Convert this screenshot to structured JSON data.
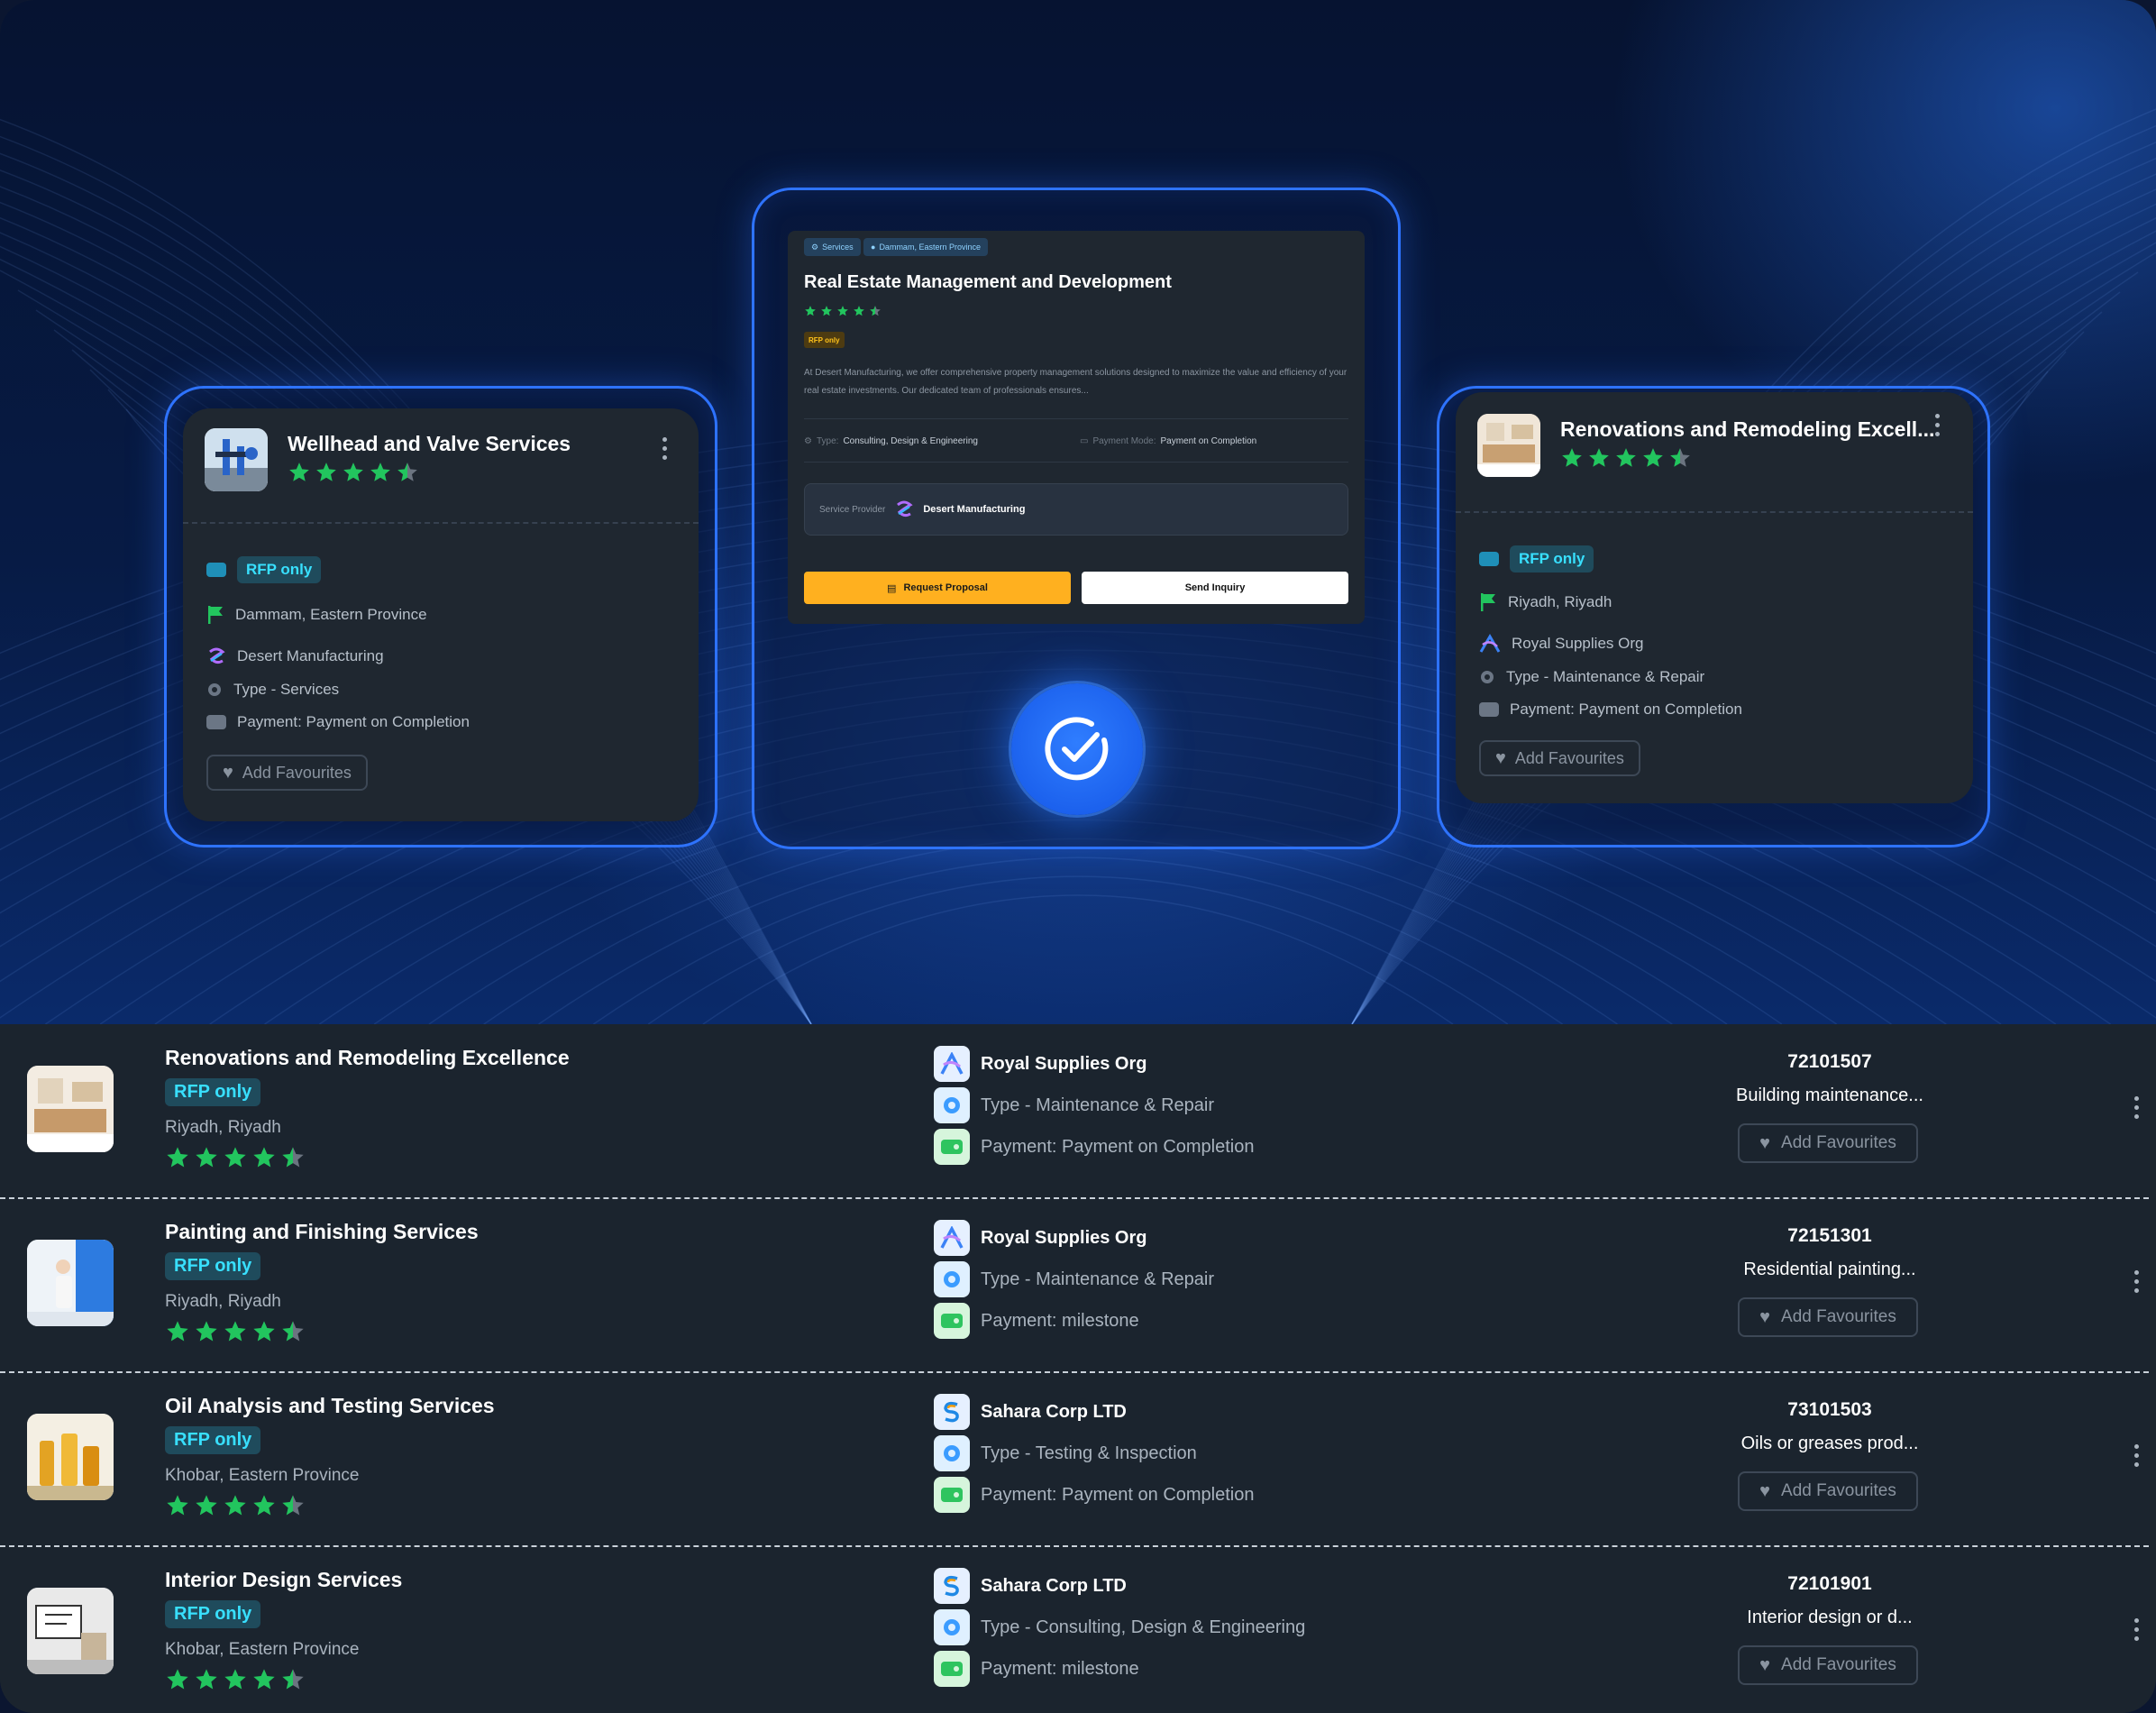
{
  "colors": {
    "accent_blue": "#2e73ff",
    "rfp_cyan": "#38e0ff",
    "star_green": "#22c55e",
    "request_orange": "#ffb01f",
    "card_bg": "#1f2730"
  },
  "center_card": {
    "chips": [
      "Services",
      "Dammam, Eastern Province"
    ],
    "title": "Real Estate Management and Development",
    "rating": 4.5,
    "rfp_label": "RFP only",
    "description": "At Desert Manufacturing, we offer comprehensive property management solutions designed to maximize the value and efficiency of your real estate investments. Our dedicated team of professionals ensures...",
    "type_label": "Type:",
    "type_value": "Consulting, Design & Engineering",
    "payment_label": "Payment Mode:",
    "payment_value": "Payment on Completion",
    "provider_label": "Service Provider",
    "provider_name": "Desert Manufacturing",
    "request_button": "Request Proposal",
    "inquiry_button": "Send Inquiry"
  },
  "left_card": {
    "title": "Wellhead and Valve Services",
    "rating": 4.5,
    "rfp_label": "RFP only",
    "location": "Dammam, Eastern Province",
    "provider": "Desert Manufacturing",
    "type": "Type - Services",
    "payment": "Payment: Payment on Completion",
    "fav_label": "Add Favourites"
  },
  "right_card": {
    "title": "Renovations and Remodeling Excell...",
    "rating": 4.5,
    "rfp_label": "RFP only",
    "location": "Riyadh, Riyadh",
    "provider": "Royal Supplies Org",
    "type": "Type - Maintenance & Repair",
    "payment": "Payment: Payment on Completion",
    "fav_label": "Add Favourites"
  },
  "list": [
    {
      "title": "Renovations and Remodeling Excellence",
      "rfp_label": "RFP only",
      "location": "Riyadh, Riyadh",
      "rating": 4.5,
      "provider": "Royal Supplies Org",
      "provider_icon": "royal-logo-icon",
      "type": "Type - Maintenance & Repair",
      "payment": "Payment: Payment on Completion",
      "code": "72101507",
      "desc": "Building maintenance...",
      "fav_label": "Add Favourites"
    },
    {
      "title": "Painting and Finishing Services",
      "rfp_label": "RFP only",
      "location": "Riyadh, Riyadh",
      "rating": 4.5,
      "provider": "Royal Supplies Org",
      "provider_icon": "royal-logo-icon",
      "type": "Type - Maintenance & Repair",
      "payment": "Payment: milestone",
      "code": "72151301",
      "desc": "Residential painting...",
      "fav_label": "Add Favourites"
    },
    {
      "title": "Oil Analysis and Testing Services",
      "rfp_label": "RFP only",
      "location": "Khobar, Eastern Province",
      "rating": 4.5,
      "provider": "Sahara Corp LTD",
      "provider_icon": "sahara-logo-icon",
      "type": "Type - Testing & Inspection",
      "payment": "Payment: Payment on Completion",
      "code": "73101503",
      "desc": "Oils or greases prod...",
      "fav_label": "Add Favourites"
    },
    {
      "title": "Interior Design Services",
      "rfp_label": "RFP only",
      "location": "Khobar, Eastern Province",
      "rating": 4.5,
      "provider": "Sahara Corp LTD",
      "provider_icon": "sahara-logo-icon",
      "type": "Type - Consulting, Design & Engineering",
      "payment": "Payment: milestone",
      "code": "72101901",
      "desc": "Interior design or d...",
      "fav_label": "Add Favourites"
    }
  ]
}
